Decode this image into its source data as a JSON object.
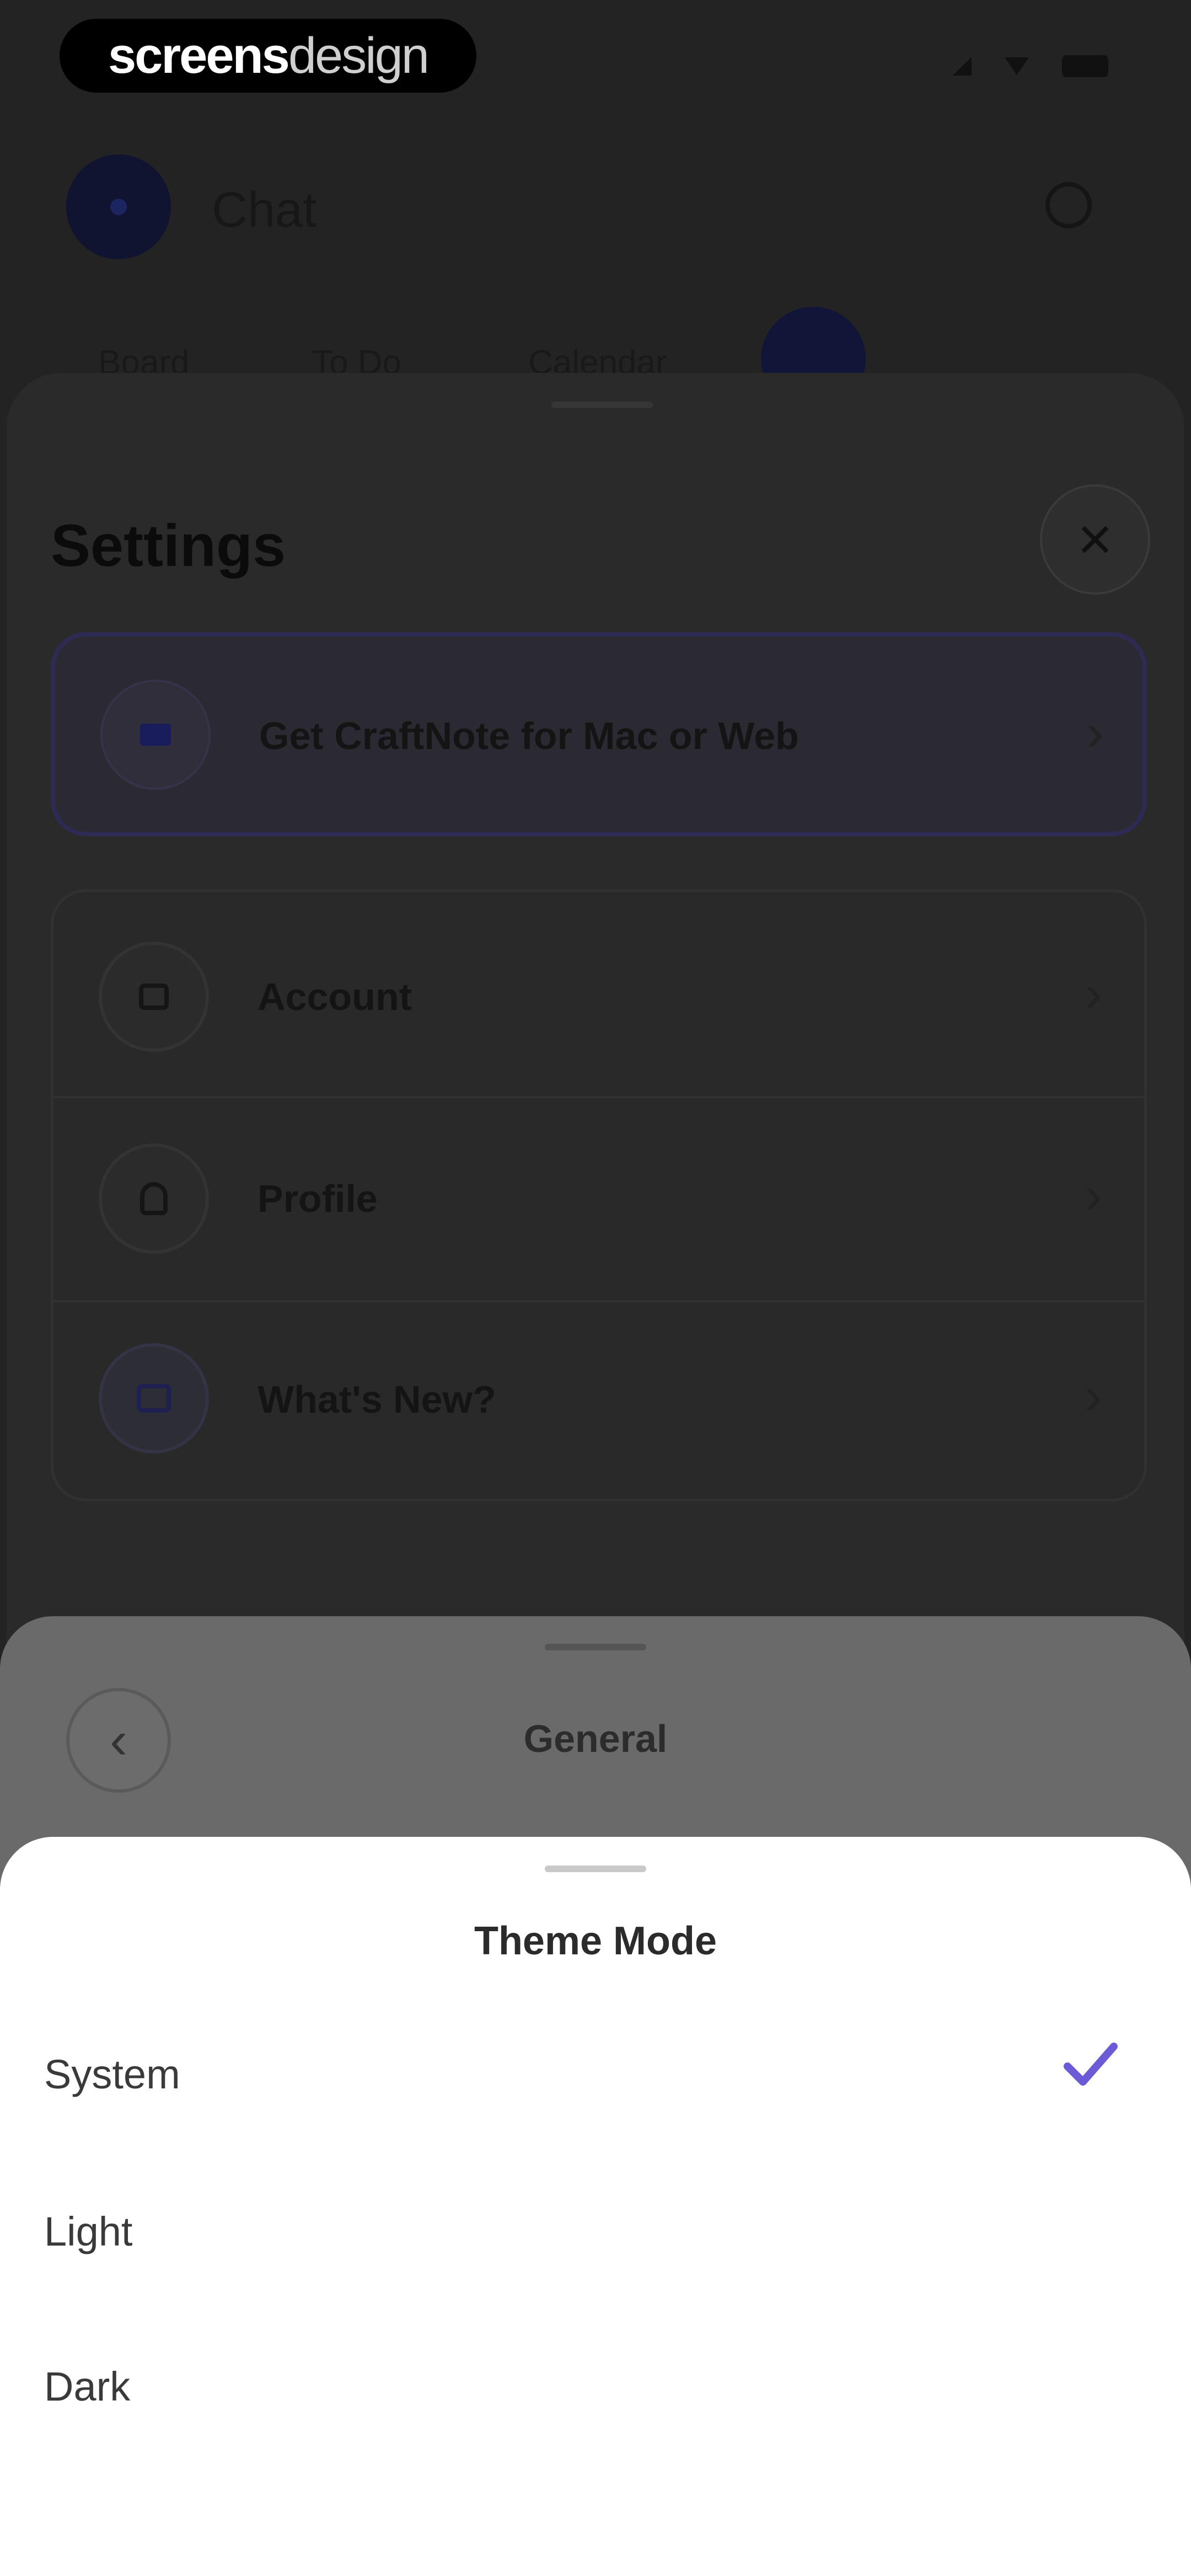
{
  "watermark": {
    "part1": "screens",
    "part2": "design"
  },
  "base": {
    "title": "Chat",
    "tabs": [
      "Board",
      "To Do",
      "Calendar"
    ]
  },
  "settings": {
    "title": "Settings",
    "close_icon": "×",
    "promo": {
      "label": "Get CraftNote for Mac or Web",
      "icon": "laptop-icon"
    },
    "chevron": "›",
    "items": [
      {
        "label": "Account",
        "icon": "lock-icon"
      },
      {
        "label": "Profile",
        "icon": "person-icon"
      },
      {
        "label": "What's New?",
        "icon": "news-icon"
      }
    ]
  },
  "general": {
    "title": "General",
    "back_icon": "‹"
  },
  "theme": {
    "title": "Theme Mode",
    "options": [
      {
        "label": "System",
        "selected": true
      },
      {
        "label": "Light",
        "selected": false
      },
      {
        "label": "Dark",
        "selected": false
      }
    ],
    "accent": "#6b5bd6"
  },
  "colors": {
    "overlay": "#232323",
    "sheet_general": "#6a6a6a",
    "sheet_theme": "#ffffff",
    "promo_border": "#2d2a54"
  }
}
